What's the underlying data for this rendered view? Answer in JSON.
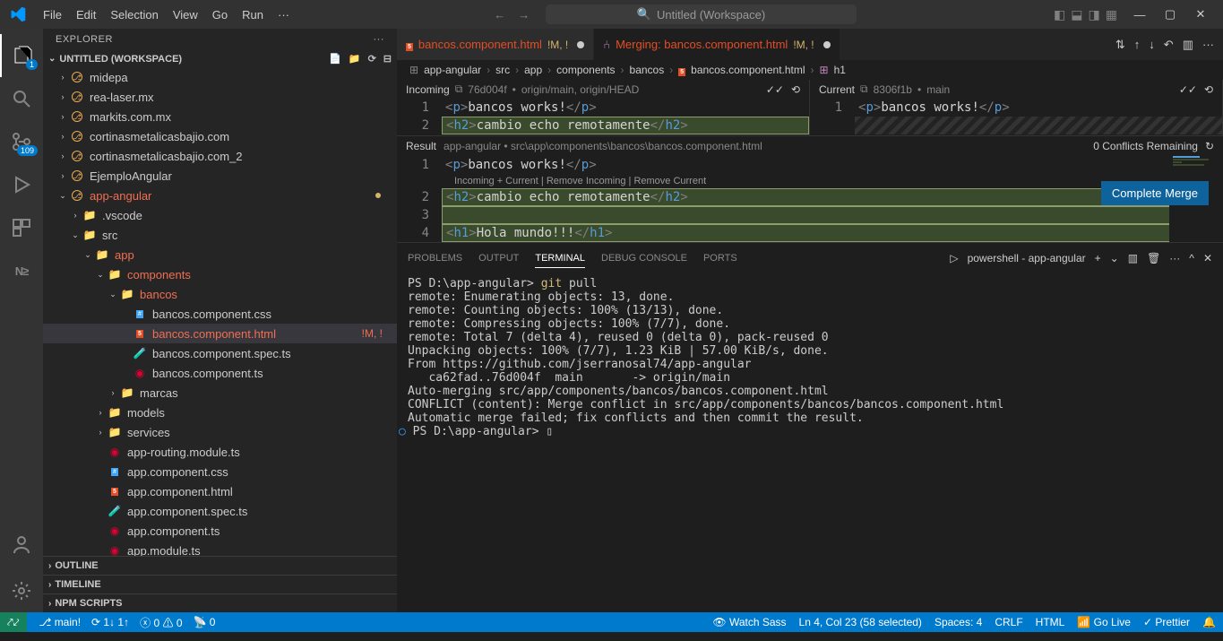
{
  "titlebar": {
    "menus": [
      "File",
      "Edit",
      "Selection",
      "View",
      "Go",
      "Run",
      "···"
    ],
    "search_placeholder": "Untitled (Workspace)"
  },
  "activitybar": {
    "explorer_badge": "1",
    "scm_badge": "109"
  },
  "sidebar": {
    "header": "EXPLORER",
    "workspace": "UNTITLED (WORKSPACE)",
    "tree": [
      {
        "indent": 1,
        "chev": "›",
        "icon": "git",
        "label": "midepa",
        "color": "#ccc"
      },
      {
        "indent": 1,
        "chev": "›",
        "icon": "git",
        "label": "rea-laser.mx",
        "color": "#ccc"
      },
      {
        "indent": 1,
        "chev": "›",
        "icon": "git",
        "label": "markits.com.mx",
        "color": "#ccc"
      },
      {
        "indent": 1,
        "chev": "›",
        "icon": "git",
        "label": "cortinasmetalicasbajio.com",
        "color": "#ccc"
      },
      {
        "indent": 1,
        "chev": "›",
        "icon": "git",
        "label": "cortinasmetalicasbajio.com_2",
        "color": "#ccc"
      },
      {
        "indent": 1,
        "chev": "›",
        "icon": "git",
        "label": "EjemploAngular",
        "color": "#ccc"
      },
      {
        "indent": 1,
        "chev": "⌄",
        "icon": "git",
        "label": "app-angular",
        "class": "staged-add",
        "dot": true
      },
      {
        "indent": 2,
        "chev": "›",
        "icon": "folder-vs",
        "label": ".vscode",
        "color": "#ccc"
      },
      {
        "indent": 2,
        "chev": "⌄",
        "icon": "folder-src",
        "label": "src",
        "color": "#ccc"
      },
      {
        "indent": 3,
        "chev": "⌄",
        "icon": "folder-app",
        "label": "app",
        "class": "staged-add"
      },
      {
        "indent": 4,
        "chev": "⌄",
        "icon": "folder-comp",
        "label": "components",
        "class": "staged-add"
      },
      {
        "indent": 5,
        "chev": "⌄",
        "icon": "folder",
        "label": "bancos",
        "class": "staged-add"
      },
      {
        "indent": 6,
        "chev": "",
        "icon": "css",
        "label": "bancos.component.css",
        "color": "#ccc"
      },
      {
        "indent": 6,
        "chev": "",
        "icon": "html",
        "label": "bancos.component.html",
        "class": "staged-add",
        "decoration": "!M, !",
        "selected": true
      },
      {
        "indent": 6,
        "chev": "",
        "icon": "ts-test",
        "label": "bancos.component.spec.ts",
        "color": "#ccc"
      },
      {
        "indent": 6,
        "chev": "",
        "icon": "ts-ng",
        "label": "bancos.component.ts",
        "color": "#ccc"
      },
      {
        "indent": 5,
        "chev": "›",
        "icon": "folder",
        "label": "marcas",
        "color": "#ccc"
      },
      {
        "indent": 4,
        "chev": "›",
        "icon": "folder-models",
        "label": "models",
        "color": "#ccc"
      },
      {
        "indent": 4,
        "chev": "›",
        "icon": "folder-services",
        "label": "services",
        "color": "#ccc"
      },
      {
        "indent": 4,
        "chev": "",
        "icon": "ts-ng",
        "label": "app-routing.module.ts",
        "color": "#ccc"
      },
      {
        "indent": 4,
        "chev": "",
        "icon": "css",
        "label": "app.component.css",
        "color": "#ccc"
      },
      {
        "indent": 4,
        "chev": "",
        "icon": "html",
        "label": "app.component.html",
        "color": "#ccc"
      },
      {
        "indent": 4,
        "chev": "",
        "icon": "ts-test",
        "label": "app.component.spec.ts",
        "color": "#ccc"
      },
      {
        "indent": 4,
        "chev": "",
        "icon": "ts-ng",
        "label": "app.component.ts",
        "color": "#ccc"
      },
      {
        "indent": 4,
        "chev": "",
        "icon": "ts-ng",
        "label": "app.module.ts",
        "color": "#ccc"
      }
    ],
    "collapsed": [
      "OUTLINE",
      "TIMELINE",
      "NPM SCRIPTS"
    ]
  },
  "tabs": [
    {
      "icon": "html",
      "label": "bancos.component.html",
      "status": "!M, !",
      "dirty": true,
      "active": false
    },
    {
      "icon": "merge",
      "label": "Merging: bancos.component.html",
      "status": "!M, !",
      "dirty": true,
      "active": true
    }
  ],
  "breadcrumb": [
    "app-angular",
    "src",
    "app",
    "components",
    "bancos",
    "bancos.component.html",
    "h1"
  ],
  "merge": {
    "incoming": {
      "title": "Incoming",
      "ref": "76d004f",
      "branch": "origin/main, origin/HEAD"
    },
    "current": {
      "title": "Current",
      "ref": "8306f1b",
      "branch": "main"
    },
    "result_title": "Result",
    "result_path": "app-angular • src\\app\\components\\bancos\\bancos.component.html",
    "conflicts": "0 Conflicts Remaining",
    "codelens": "Incoming + Current | Remove Incoming | Remove Current",
    "complete_btn": "Complete Merge",
    "lines_incoming": [
      {
        "n": "1",
        "html": "<p>bancos works!</p>"
      },
      {
        "n": "2",
        "html": "<h2>cambio echo remotamente</h2>",
        "hl": "green"
      }
    ],
    "lines_current": [
      {
        "n": "1",
        "html": "<p>bancos works!</p>"
      },
      {
        "n": "",
        "html": "",
        "hl": "striped"
      }
    ],
    "lines_result": [
      {
        "n": "1",
        "html": "<p>bancos works!</p>"
      },
      {
        "n": "2",
        "html": "<h2>cambio echo remotamente</h2>",
        "hl": "green"
      },
      {
        "n": "3",
        "html": "",
        "hl": "green"
      },
      {
        "n": "4",
        "html": "<h1>Hola mundo!!!</h1>",
        "hl": "green"
      }
    ]
  },
  "panel": {
    "tabs": [
      "PROBLEMS",
      "OUTPUT",
      "TERMINAL",
      "DEBUG CONSOLE",
      "PORTS"
    ],
    "active_tab": "TERMINAL",
    "terminal_label": "powershell - app-angular",
    "terminal_lines": [
      {
        "t": "PS D:\\app-angular> ",
        "y": "git ",
        "w": "pull"
      },
      {
        "t": "remote: Enumerating objects: 13, done."
      },
      {
        "t": "remote: Counting objects: 100% (13/13), done."
      },
      {
        "t": "remote: Compressing objects: 100% (7/7), done."
      },
      {
        "t": "remote: Total 7 (delta 4), reused 0 (delta 0), pack-reused 0"
      },
      {
        "t": "Unpacking objects: 100% (7/7), 1.23 KiB | 57.00 KiB/s, done."
      },
      {
        "t": "From https://github.com/jserranosal74/app-angular"
      },
      {
        "t": "   ca62fad..76d004f  main       -> origin/main"
      },
      {
        "t": "Auto-merging src/app/components/bancos/bancos.component.html"
      },
      {
        "t": "CONFLICT (content): Merge conflict in src/app/components/bancos/bancos.component.html"
      },
      {
        "t": "Automatic merge failed; fix conflicts and then commit the result."
      },
      {
        "t": "PS D:\\app-angular> ▯",
        "circle": true
      }
    ]
  },
  "statusbar": {
    "branch": "main!",
    "sync": "1↓ 1↑",
    "errors": "0",
    "warnings": "0",
    "ports": "0",
    "watch": "Watch Sass",
    "cursor": "Ln 4, Col 23 (58 selected)",
    "spaces": "Spaces: 4",
    "eol": "CRLF",
    "lang": "HTML",
    "live": "Go Live",
    "prettier": "Prettier"
  }
}
